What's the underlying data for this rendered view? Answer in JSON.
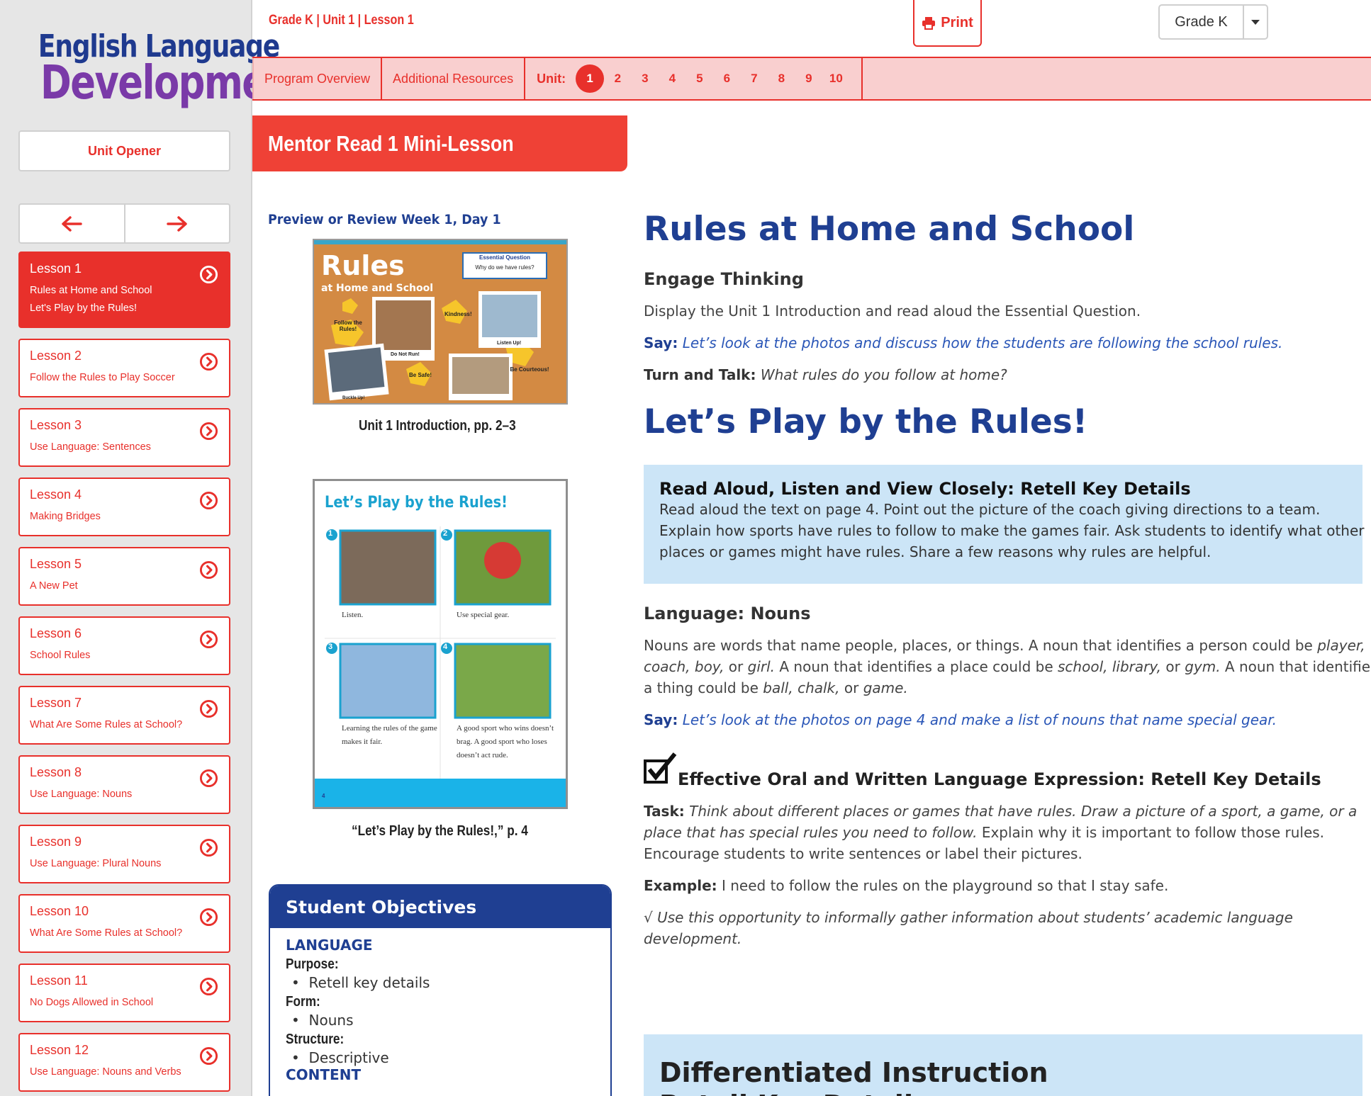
{
  "logo": {
    "line1": "English Language",
    "line2": "Development"
  },
  "sidebar": {
    "unit_opener": "Unit Opener",
    "lessons": [
      {
        "num": "Lesson 1",
        "title": "Rules at Home and School",
        "subtitle": "Let's Play by the Rules!",
        "active": true
      },
      {
        "num": "Lesson 2",
        "title": "Follow the Rules to Play Soccer"
      },
      {
        "num": "Lesson 3",
        "title": "Use Language: Sentences"
      },
      {
        "num": "Lesson 4",
        "title": "Making Bridges"
      },
      {
        "num": "Lesson 5",
        "title": "A New Pet"
      },
      {
        "num": "Lesson 6",
        "title": "School Rules"
      },
      {
        "num": "Lesson 7",
        "title": "What Are Some Rules at School?"
      },
      {
        "num": "Lesson 8",
        "title": "Use Language: Nouns"
      },
      {
        "num": "Lesson 9",
        "title": "Use Language: Plural Nouns"
      },
      {
        "num": "Lesson 10",
        "title": "What Are Some Rules at School?"
      },
      {
        "num": "Lesson 11",
        "title": "No Dogs Allowed in School"
      },
      {
        "num": "Lesson 12",
        "title": "Use Language: Nouns and Verbs"
      }
    ]
  },
  "header": {
    "breadcrumb": "Grade K | Unit 1 | Lesson 1",
    "print_label": "Print",
    "grade_value": "Grade K"
  },
  "topnav": {
    "program_overview": "Program Overview",
    "additional_resources": "Additional Resources",
    "unit_label": "Unit:",
    "units": [
      "1",
      "2",
      "3",
      "4",
      "5",
      "6",
      "7",
      "8",
      "9",
      "10"
    ],
    "active_unit": "1"
  },
  "section_title": "Mentor Read 1 Mini-Lesson",
  "left_column": {
    "preview_label": "Preview or Review Week 1, Day 1",
    "image1": {
      "caption": "Unit 1 Introduction, pp. 2–3",
      "title": "Rules",
      "subtitle": "at Home and School",
      "eq_label": "Essential Question",
      "eq_text": "Why do we have rules?",
      "stickers": [
        "Follow the Rules!",
        "Kindness!",
        "Do Not Run!",
        "Listen Up!",
        "Be Safe!",
        "Be Courteous!",
        "Buckle Up!"
      ]
    },
    "image2": {
      "caption": "“Let’s Play by the Rules!,” p. 4",
      "title": "Let’s Play by the Rules!",
      "panels": [
        {
          "n": "1",
          "text": "Listen."
        },
        {
          "n": "2",
          "text": "Use special gear."
        },
        {
          "n": "3",
          "text": "Learning the rules of the game makes it fair."
        },
        {
          "n": "4",
          "text": "A good sport who wins doesn’t brag. A good sport who loses doesn’t act rude."
        }
      ],
      "page": "4"
    },
    "objectives": {
      "heading": "Student Objectives",
      "language_label": "LANGUAGE",
      "purpose_label": "Purpose:",
      "purpose_item": "Retell key details",
      "form_label": "Form:",
      "form_item": "Nouns",
      "structure_label": "Structure:",
      "structure_item": "Descriptive",
      "content_label": "CONTENT"
    }
  },
  "main": {
    "h1_rules": "Rules at Home and School",
    "engage_heading": "Engage Thinking",
    "engage_text": "Display the Unit 1 Introduction and read aloud the Essential Question.",
    "say1_label": "Say:",
    "say1_text": "Let’s look at the photos and discuss how the students are following the school rules.",
    "turn_label": "Turn and Talk:",
    "turn_text": "What rules do you follow at home?",
    "h1_play": "Let’s Play by the Rules!",
    "readaloud_heading": "Read Aloud, Listen and View Closely: Retell Key Details",
    "readaloud_l1": "Read aloud the text on page 4. Point out the picture of the coach giving directions to a team.",
    "readaloud_l2": "Explain how sports have rules to follow to make the games fair. Ask students to identify what other",
    "readaloud_l3": "places or games might have rules. Share a few reasons why rules are helpful.",
    "nouns_heading": "Language: Nouns",
    "nouns_l1a": "Nouns are words that name people, places, or things. A noun that identifies a person could be ",
    "nouns_l1b": "player,",
    "nouns_l2a": "coach, boy,",
    "nouns_l2b": " or ",
    "nouns_l2c": "girl.",
    "nouns_l2d": " A noun that identifies a place could be ",
    "nouns_l2e": "school, library,",
    "nouns_l2f": " or ",
    "nouns_l2g": "gym.",
    "nouns_l2h": " A noun that identifies",
    "nouns_l3a": "a thing could be ",
    "nouns_l3b": "ball, chalk,",
    "nouns_l3c": " or ",
    "nouns_l3d": "game.",
    "say2_label": "Say:",
    "say2_text": "Let’s look at the photos on page 4 and make a list of nouns that name special gear.",
    "expression_heading": "Effective Oral and Written Language Expression: Retell Key Details",
    "task_label": "Task:",
    "task_l1": "Think about different places or games that have rules. Draw a picture of a sport, a game, or a",
    "task_l2a": "place that has special rules you need to follow.",
    "task_l2b": " Explain why it is important to follow those rules.",
    "task_l3": "Encourage students to write sentences or label their pictures.",
    "example_label": "Example:",
    "example_text": "I need to follow the rules on the playground so that I stay safe.",
    "note_l1": "√ Use this opportunity to informally gather information about students’ academic language",
    "note_l2": "development.",
    "diff_heading": "Differentiated Instruction",
    "diff_sub": "Retell Key Details"
  },
  "colors": {
    "accent_red": "#e8302b",
    "nav_pink": "#f9cfcf",
    "heading_blue": "#1f3f92",
    "say_blue": "#2a56b7",
    "callout_blue": "#cce5f7",
    "logo_purple": "#7a3aa8"
  },
  "icons": {
    "print": "printer-icon",
    "dropdown": "caret-down-icon",
    "prev": "arrow-left-icon",
    "next": "arrow-right-icon",
    "lesson_go": "circle-chevron-right-icon",
    "checkbox": "checkbox-checked-icon"
  }
}
